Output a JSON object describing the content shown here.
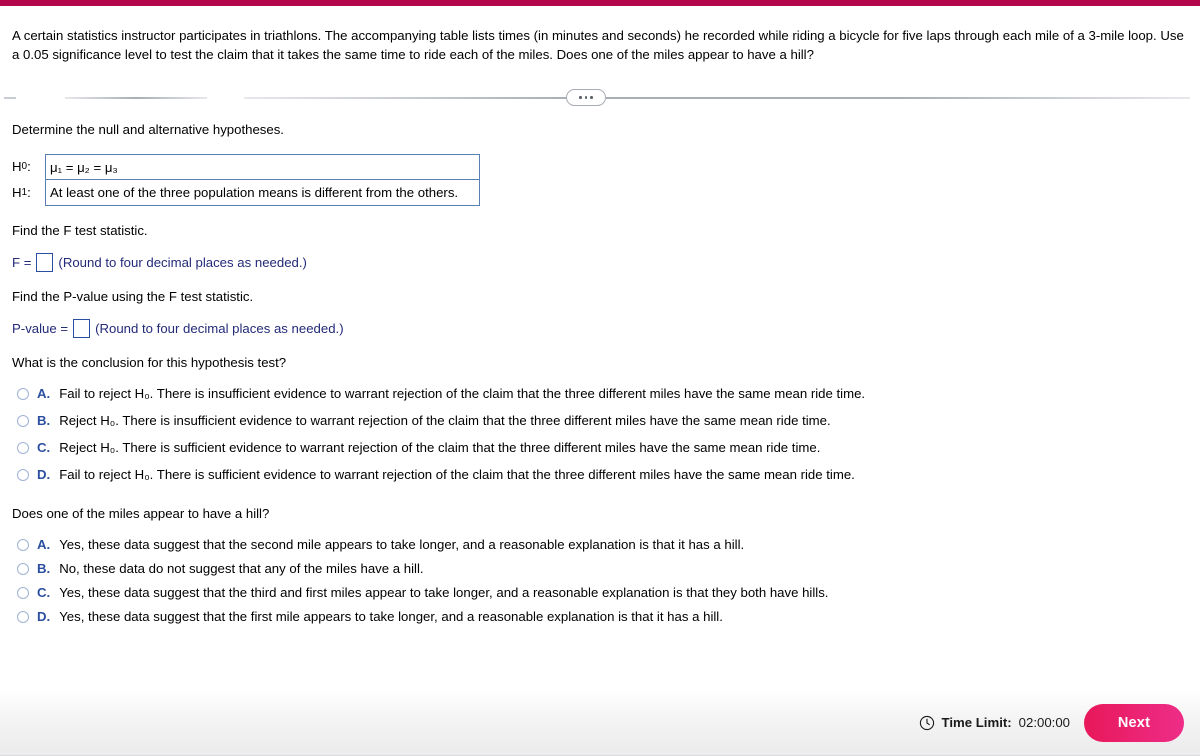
{
  "top_accent_color": "#b4064a",
  "problem": {
    "text": "A certain statistics instructor participates in triathlons. The accompanying table lists times (in minutes and seconds) he recorded while riding a bicycle for five laps through each mile of a 3-mile loop. Use a 0.05 significance level to test the claim that it takes the same time to ride each of the miles. Does one of the miles appear to have a hill?"
  },
  "divider": {
    "dots_label": "•••"
  },
  "hypotheses": {
    "prompt": "Determine the null and alternative hypotheses.",
    "null_label": "H",
    "null_sub": "0",
    "null_colon": ":",
    "null_value": "μ₁ = μ₂ = μ₃",
    "alt_label": "H",
    "alt_sub": "1",
    "alt_colon": ":",
    "alt_value": "At least one of the three population means is different from the others."
  },
  "f_statistic": {
    "prompt": "Find the F test statistic.",
    "lead": "F =",
    "value": "",
    "hint": "(Round to four decimal places as needed.)"
  },
  "p_value": {
    "prompt": "Find the P-value using the F test statistic.",
    "lead": "P-value =",
    "value": "",
    "hint": "(Round to four decimal places as needed.)"
  },
  "conclusion_question": {
    "prompt": "What is the conclusion for this hypothesis test?",
    "options": [
      {
        "letter": "A.",
        "text": "Fail to reject H₀. There is insufficient evidence to warrant rejection of the claim that the three different miles have the same mean ride time."
      },
      {
        "letter": "B.",
        "text": "Reject H₀. There is insufficient evidence to warrant rejection of the claim that the three different miles have the same mean ride time."
      },
      {
        "letter": "C.",
        "text": "Reject H₀. There is sufficient evidence to warrant rejection of the claim that the three different miles have the same mean ride time."
      },
      {
        "letter": "D.",
        "text": "Fail to reject H₀. There is sufficient evidence to warrant rejection of the claim that the three different miles have the same mean ride time."
      }
    ]
  },
  "hill_question": {
    "prompt": "Does one of the miles appear to have a hill?",
    "options": [
      {
        "letter": "A.",
        "text": "Yes, these data suggest that the second mile appears to take longer, and a reasonable explanation is that it has a hill."
      },
      {
        "letter": "B.",
        "text": "No, these data do not suggest that any of the miles have a hill."
      },
      {
        "letter": "C.",
        "text": "Yes, these data suggest that the third and first miles appear to take longer, and a reasonable explanation is that they both have hills."
      },
      {
        "letter": "D.",
        "text": "Yes, these data suggest that the first mile appears to take longer, and a reasonable explanation is that it has a hill."
      }
    ]
  },
  "footer": {
    "time_limit_label": "Time Limit:",
    "time_limit_value": "02:00:00",
    "next_label": "Next",
    "button_color": "#e8185a"
  }
}
